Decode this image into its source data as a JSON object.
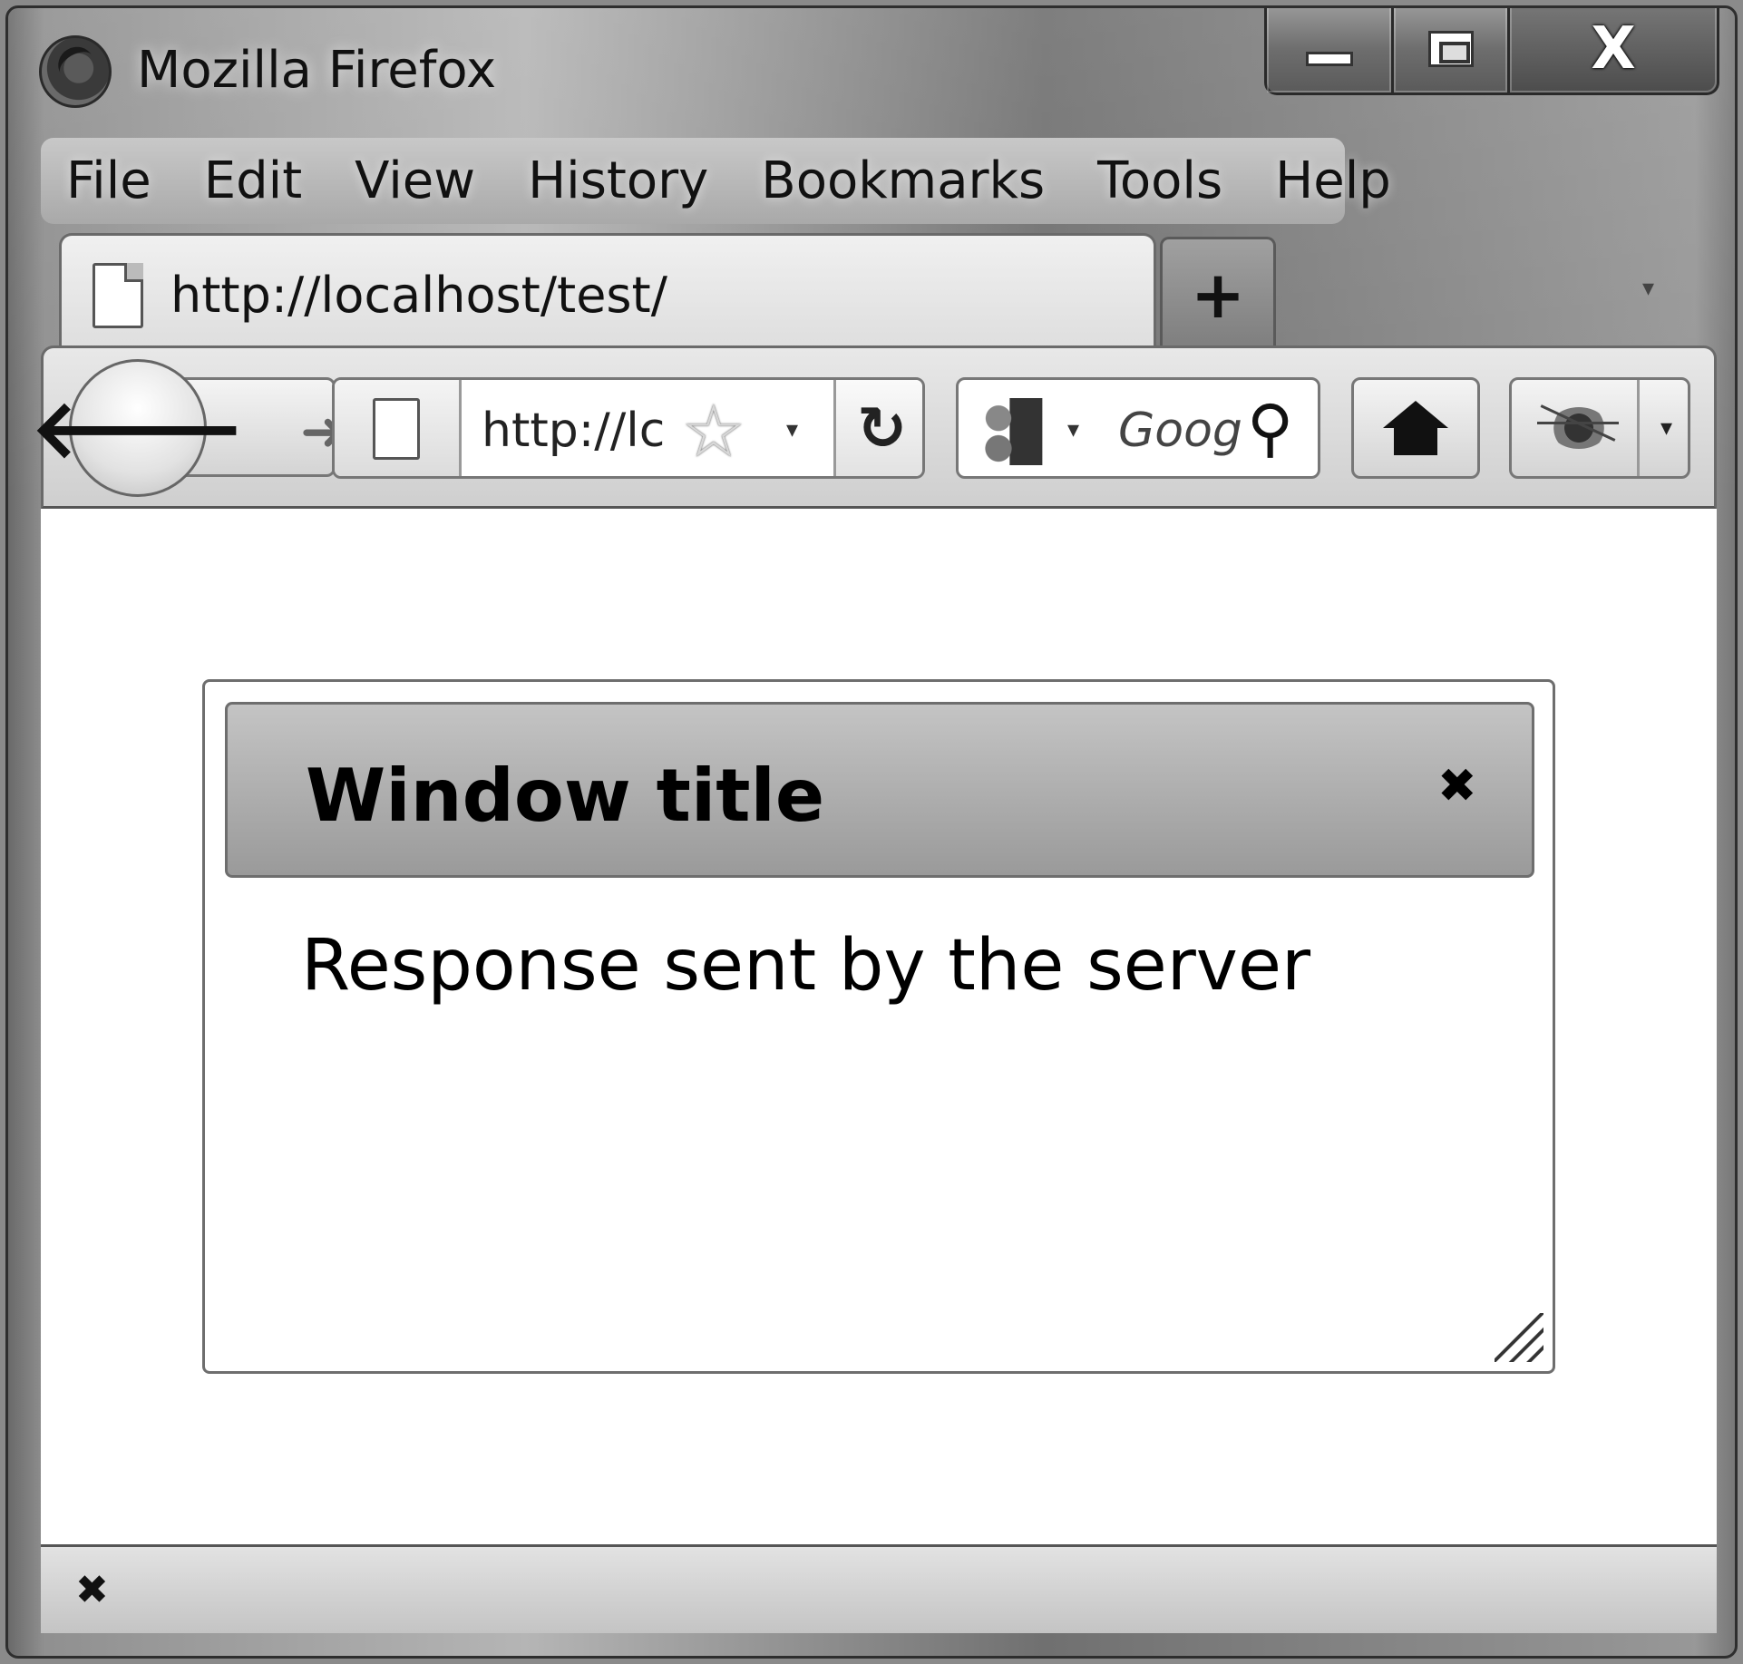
{
  "window": {
    "title": "Mozilla Firefox",
    "close_glyph": "X"
  },
  "menubar": {
    "items": [
      "File",
      "Edit",
      "View",
      "History",
      "Bookmarks",
      "Tools",
      "Help"
    ]
  },
  "tabs": [
    {
      "title": "http://localhost/test/",
      "icon": "page-icon",
      "active": true
    }
  ],
  "tabstrip": {
    "new_tab_label": "+",
    "list_all_tabs_glyph": "▾"
  },
  "navbar": {
    "back_glyph": "🡐",
    "forward_glyph": "➜",
    "url_value": "http://lc",
    "star_glyph": "☆",
    "dropdown_glyph": "▾",
    "reload_glyph": "↻",
    "search_engine_dropdown_glyph": "▾",
    "search_placeholder": "Goog",
    "search_glyph": "⚲",
    "addon_dropdown_glyph": "▾"
  },
  "dialog": {
    "title": "Window title",
    "close_glyph": "✖",
    "body": "Response sent by the server"
  },
  "statusbar": {
    "close_glyph": "✖"
  },
  "colors": {
    "frame": "#8a8a8a",
    "content_bg": "#ffffff",
    "dialog_titlebar": "#a8a8a8"
  }
}
